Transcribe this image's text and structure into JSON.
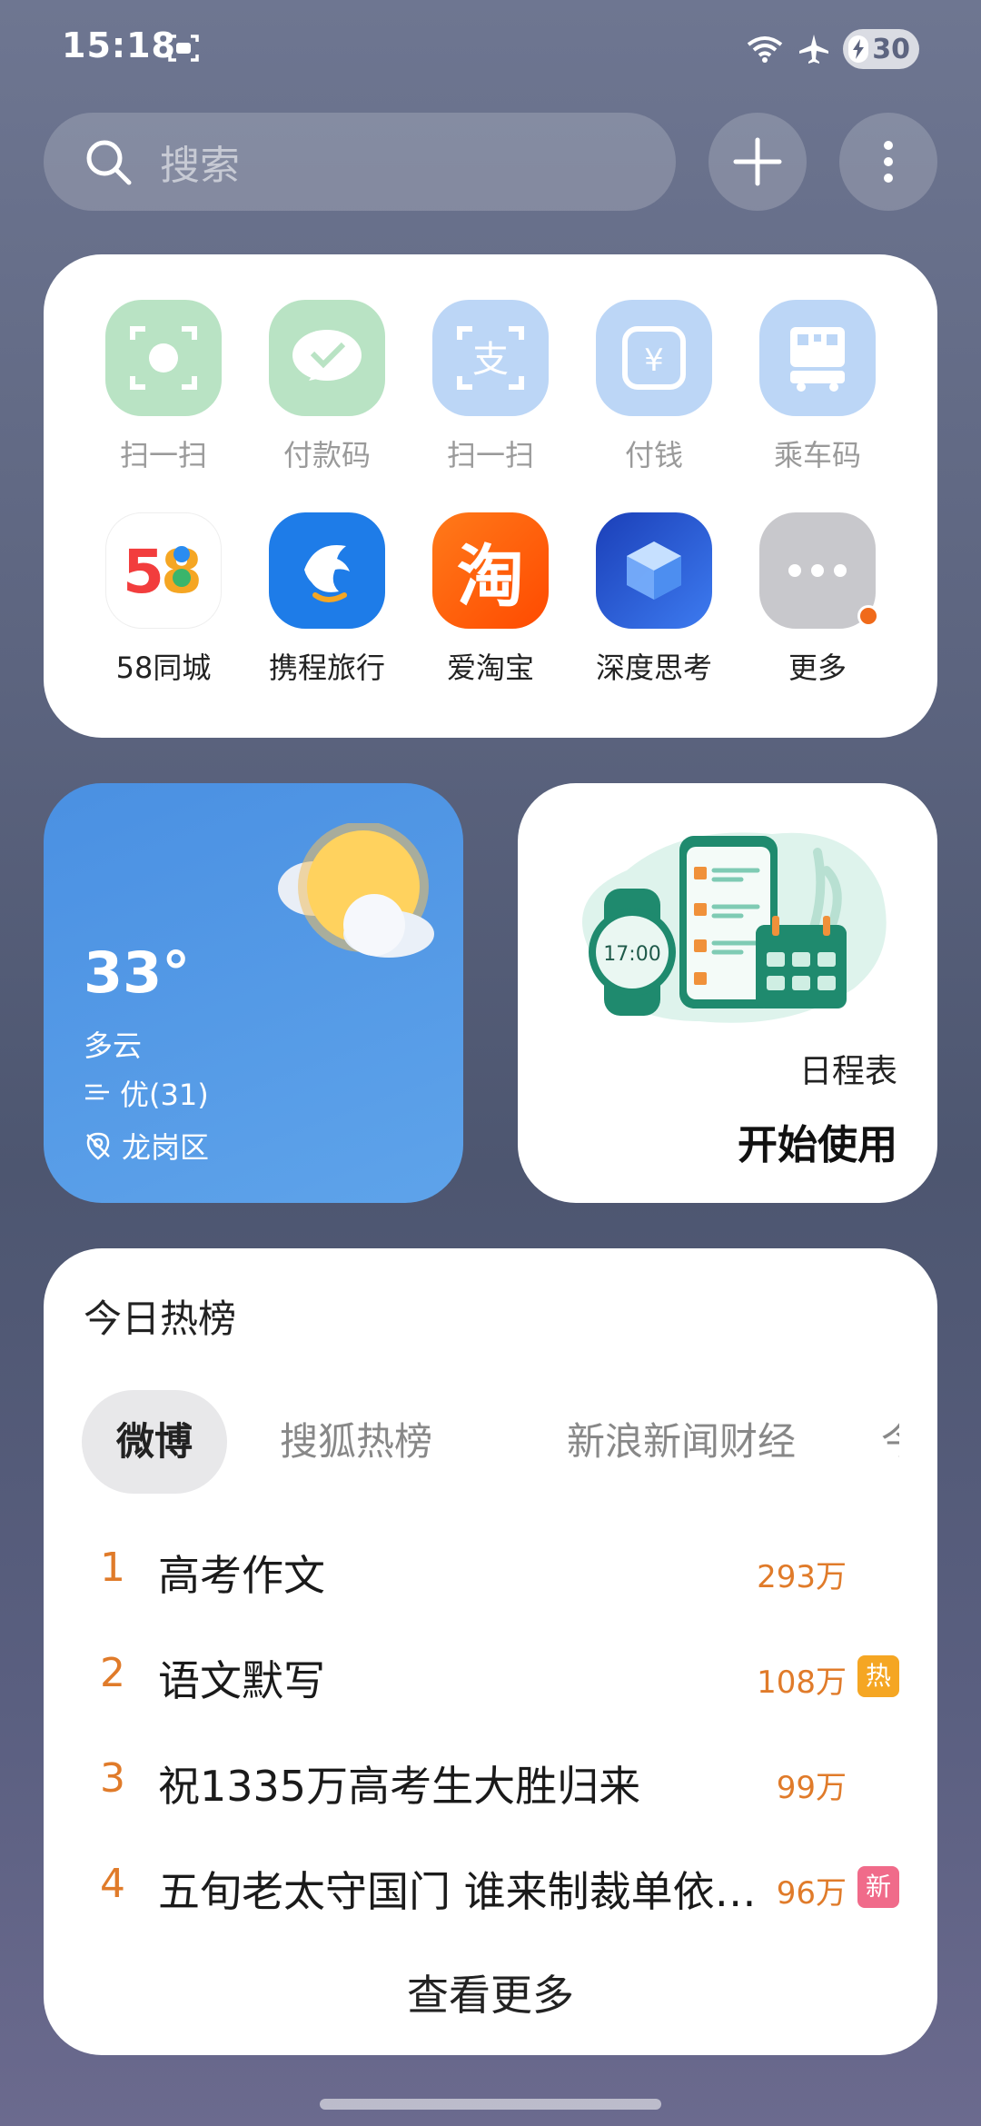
{
  "status": {
    "time": "15:18",
    "battery": "30"
  },
  "search": {
    "placeholder": "搜索"
  },
  "apps_row1": [
    {
      "label": "扫一扫",
      "icon": "wechat-scan-icon",
      "color": "#b9e3c4"
    },
    {
      "label": "付款码",
      "icon": "wechat-pay-icon",
      "color": "#b9e3c4"
    },
    {
      "label": "扫一扫",
      "icon": "alipay-scan-icon",
      "color": "#bcd6f6"
    },
    {
      "label": "付钱",
      "icon": "alipay-pay-icon",
      "color": "#bcd6f6"
    },
    {
      "label": "乘车码",
      "icon": "bus-code-icon",
      "color": "#bcd6f6"
    }
  ],
  "apps_row2": [
    {
      "label": "58同城",
      "icon": "58-logo-icon"
    },
    {
      "label": "携程旅行",
      "icon": "ctrip-dolphin-icon",
      "color": "#1e7ce8"
    },
    {
      "label": "爱淘宝",
      "icon": "taobao-icon",
      "color": "#ff5a00",
      "glyph": "淘"
    },
    {
      "label": "深度思考",
      "icon": "deep-think-cube-icon",
      "color": "#2f5fd6"
    },
    {
      "label": "更多",
      "icon": "more-dots-icon",
      "color": "#c8c8cc"
    }
  ],
  "weather": {
    "temp": "33°",
    "condition": "多云",
    "aqi": "优(31)",
    "location": "龙岗区"
  },
  "schedule": {
    "clock": "17:00",
    "title": "日程表",
    "action": "开始使用"
  },
  "hot": {
    "title": "今日热榜",
    "tabs": [
      "微博",
      "搜狐热榜",
      "新浪新闻财经",
      "今日"
    ],
    "items": [
      {
        "rank": "1",
        "title": "高考作文",
        "count": "293万",
        "badge": ""
      },
      {
        "rank": "2",
        "title": "语文默写",
        "count": "108万",
        "badge": "热",
        "badge_color": "#f5a623"
      },
      {
        "rank": "3",
        "title": "祝1335万高考生大胜归来",
        "count": "99万",
        "badge": ""
      },
      {
        "rank": "4",
        "title": "五旬老太守国门 谁来制裁单依…",
        "count": "96万",
        "badge": "新",
        "badge_color": "#f06b8a"
      }
    ],
    "more": "查看更多"
  }
}
